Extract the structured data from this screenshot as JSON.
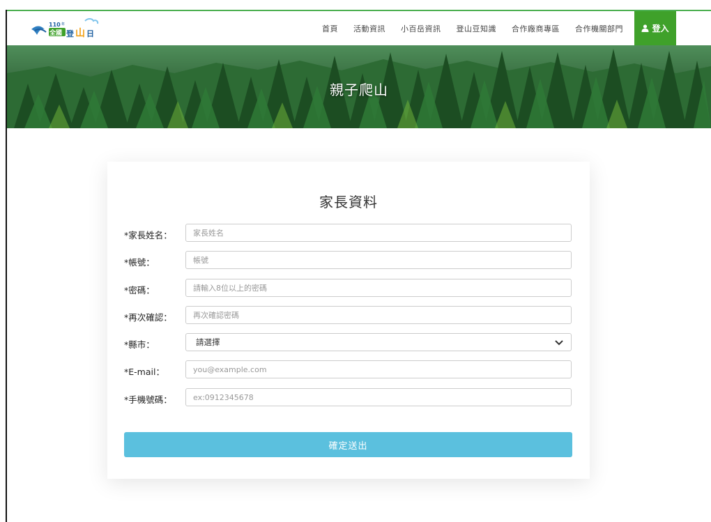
{
  "nav": {
    "logo_text": "110年全國登山日",
    "items": [
      {
        "label": "首頁"
      },
      {
        "label": "活動資訊"
      },
      {
        "label": "小百岳資訊"
      },
      {
        "label": "登山豆知識"
      },
      {
        "label": "合作廠商專區"
      },
      {
        "label": "合作機關部門"
      }
    ],
    "login_label": "登入",
    "accent_color": "#3fa12a"
  },
  "banner": {
    "title": "親子爬山"
  },
  "form": {
    "title": "家長資料",
    "fields": [
      {
        "label": "*家長姓名：",
        "placeholder": "家長姓名",
        "value": ""
      },
      {
        "label": "*帳號：",
        "placeholder": "帳號",
        "value": ""
      },
      {
        "label": "*密碼：",
        "placeholder": "請輸入8位以上的密碼",
        "value": ""
      },
      {
        "label": "*再次確認：",
        "placeholder": "再次確認密碼",
        "value": ""
      },
      {
        "label": "*縣市：",
        "selected": "請選擇"
      },
      {
        "label": "*E-mail：",
        "placeholder": "you@example.com",
        "value": ""
      },
      {
        "label": "*手機號碼：",
        "placeholder": "ex:0912345678",
        "value": ""
      }
    ],
    "submit_label": "確定送出",
    "submit_color": "#5bc0de"
  }
}
